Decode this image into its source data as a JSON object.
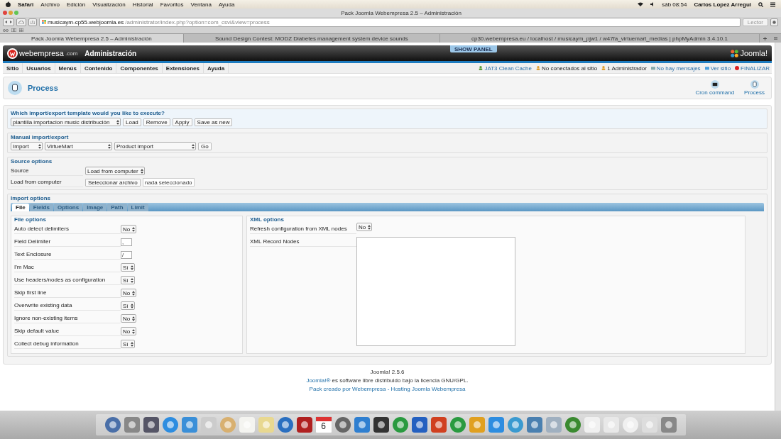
{
  "menubar": {
    "app": "Safari",
    "items": [
      "Archivo",
      "Edición",
      "Visualización",
      "Historial",
      "Favoritos",
      "Ventana",
      "Ayuda"
    ],
    "time": "sáb 08:54",
    "user": "Carlos Lopez Arregui"
  },
  "browser": {
    "title": "Pack Joomla Webempresa 2.5 – Administración",
    "url_host": "musicaym-cp55.webjoomla.es",
    "url_path": "/administrator/index.php?option=com_csvi&view=process",
    "reader": "Lector",
    "tabs": [
      {
        "label": "Pack Joomla Webempresa 2.5 – Administración",
        "selected": true
      },
      {
        "label": "Sound Design Contest: MODZ Diabetes management system device sounds",
        "selected": false
      },
      {
        "label": "cp30.webempresa.eu / localhost / musicaym_pjw1 / w47fa_virtuemart_medias | phpMyAdmin 3.4.10.1",
        "selected": false
      }
    ]
  },
  "header": {
    "brand": "webempresa",
    "brand_suffix": ".com",
    "title": "Administración",
    "show_panel": "SHOW PANEL",
    "joomla": "Joomla!"
  },
  "menu": [
    "Sitio",
    "Usuarios",
    "Menús",
    "Contenido",
    "Componentes",
    "Extensiones",
    "Ayuda"
  ],
  "status": [
    {
      "kind": "cache",
      "label": "JAT3 Clean Cache"
    },
    {
      "kind": "users",
      "label": "No conectados al sitio"
    },
    {
      "kind": "admin",
      "label": "1 Administrador"
    },
    {
      "kind": "mail",
      "label": "No hay mensajes"
    },
    {
      "kind": "site",
      "label": "Ver sitio"
    },
    {
      "kind": "logout",
      "label": "FINALIZAR"
    }
  ],
  "page_title": "Process",
  "toolbar": [
    {
      "kind": "cron",
      "label": "Cron command"
    },
    {
      "kind": "process",
      "label": "Process"
    }
  ],
  "template": {
    "legend": "Which import/export template would you like to execute?",
    "select": "plantilla importacion music distribución",
    "buttons": [
      "Load",
      "Remove",
      "Apply",
      "Save as new"
    ]
  },
  "manual": {
    "legend": "Manual import/export",
    "selects": [
      "Import",
      "VirtueMart",
      "Product import"
    ],
    "button": "Go"
  },
  "source": {
    "legend": "Source options",
    "source_label": "Source",
    "source_value": "Load from computer",
    "file_label": "Load from computer",
    "file_button": "Seleccionar archivo",
    "file_status": "nada seleccionado"
  },
  "import": {
    "legend": "Import options",
    "tabs": [
      {
        "label": "File",
        "selected": true
      },
      {
        "label": "Fields",
        "selected": false
      },
      {
        "label": "Options",
        "selected": false
      },
      {
        "label": "Image",
        "selected": false
      },
      {
        "label": "Path",
        "selected": false
      },
      {
        "label": "Limit",
        "selected": false
      }
    ],
    "file_options": {
      "legend": "File options",
      "rows": [
        {
          "label": "Auto detect delimiters",
          "kind": "select",
          "value": "No"
        },
        {
          "label": "Field Delimiter",
          "kind": "text",
          "value": ","
        },
        {
          "label": "Text Enclosure",
          "kind": "text",
          "value": "/"
        },
        {
          "label": "I'm Mac",
          "kind": "select",
          "value": "Sí"
        },
        {
          "label": "Use headers/nodes as configuration",
          "kind": "select",
          "value": "Sí"
        },
        {
          "label": "Skip first line",
          "kind": "select",
          "value": "No"
        },
        {
          "label": "Overwrite existing data",
          "kind": "select",
          "value": "Sí"
        },
        {
          "label": "Ignore non-existing items",
          "kind": "select",
          "value": "No"
        },
        {
          "label": "Skip default value",
          "kind": "select",
          "value": "No"
        },
        {
          "label": "Collect debug information",
          "kind": "select",
          "value": "Sí"
        }
      ]
    },
    "xml_options": {
      "legend": "XML options",
      "rows": [
        {
          "label": "Refresh configuration from XML nodes",
          "kind": "select",
          "value": "No"
        },
        {
          "label": "XML Record Nodes",
          "kind": "textarea",
          "value": ""
        }
      ]
    }
  },
  "footer": {
    "version": "Joomla! 2.5.6",
    "link": "Joomla!®",
    "license": "es software libre distribuido bajo la licencia GNU/GPL.",
    "credits": "Pack creado por Webempresa - Hosting Joomla Webempresa"
  },
  "dock": {
    "calendar_day": "6"
  }
}
